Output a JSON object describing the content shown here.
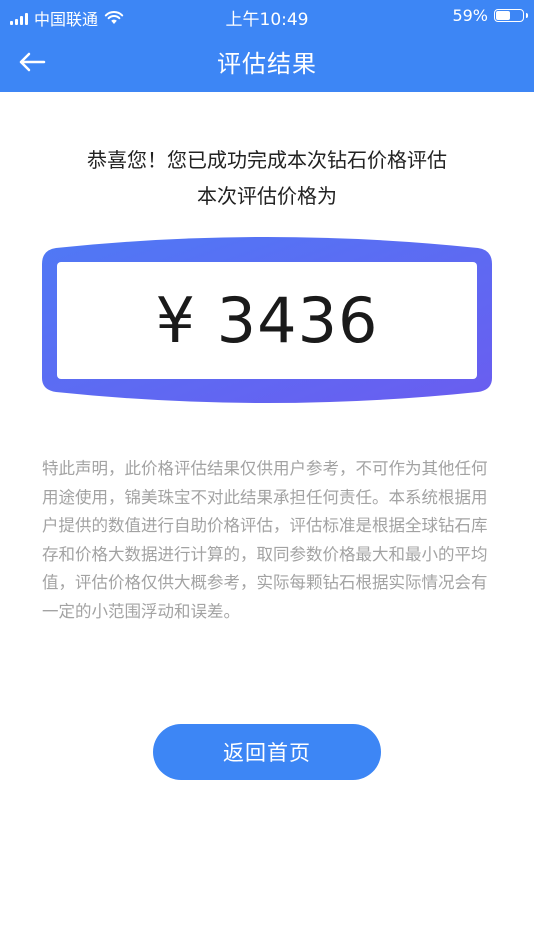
{
  "status_bar": {
    "carrier": "中国联通",
    "time": "上午10:49",
    "battery_percent": "59%",
    "battery_level": 0.59,
    "signal_icon": "signal-icon",
    "wifi_icon": "wifi-icon",
    "battery_icon": "battery-icon"
  },
  "nav": {
    "title": "评估结果",
    "back_icon": "back-arrow-icon"
  },
  "result": {
    "congrats": "恭喜您！您已成功完成本次钻石价格评估",
    "subline": "本次评估价格为",
    "price": "¥ 3436"
  },
  "disclaimer": "特此声明，此价格评估结果仅供用户参考，不可作为其他任何用途使用，锦美珠宝不对此结果承担任何责任。本系统根据用户提供的数值进行自助价格评估，评估标准是根据全球钻石库存和价格大数据进行计算的，取同参数价格最大和最小的平均值，评估价格仅供大概参考，实际每颗钻石根据实际情况会有一定的小范围浮动和误差。",
  "actions": {
    "home_label": "返回首页"
  },
  "colors": {
    "primary": "#3d86f5",
    "frame_gradient_start": "#4f79f5",
    "frame_gradient_end": "#6a5df0",
    "disclaimer_text": "#a3a3a3"
  }
}
